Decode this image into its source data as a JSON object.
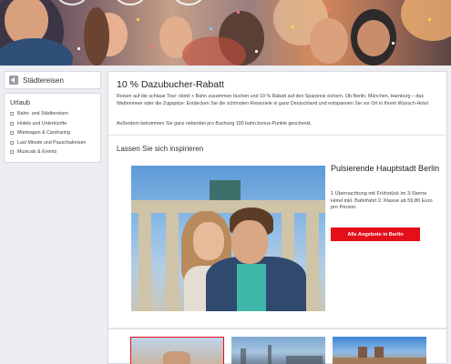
{
  "sidebar": {
    "back_label": "Städtereisen",
    "nav_title": "Urlaub",
    "items": [
      {
        "label": "Bahn- und Städtereisen"
      },
      {
        "label": "Hotels und Unterkünfte"
      },
      {
        "label": "Mietwagen & Carsharing"
      },
      {
        "label": "Last Minute und Pauschalreisen"
      },
      {
        "label": "Musicals & Events"
      }
    ]
  },
  "main": {
    "title": "10 % Dazubucher-Rabatt",
    "intro": "Reisen auf die schlaue Tour: Hotel + Bahn zusammen buchen und 10 % Rabatt auf den Sparpreis sichern. Ob Berlin, München, Hamburg – das Wattenmeer oder die Zugspitze: Entdecken Sie die schönsten Reiseziele in ganz Deutschland und entspannen Sie vor Ort in Ihrem Wunsch-Hotel.",
    "intro2": "Außerdem bekommen Sie ganz nebenbei pro Buchung 100 bahn.bonus-Punkte geschenkt.",
    "inspire_heading": "Lassen Sie sich inspirieren",
    "offer": {
      "city_title": "Pulsierende Hauptstadt Berlin",
      "description": "1 Übernachtung mit Frühstück im 3-Sterne Hotel inkl. Bahnfahrt 2. Klasse ab 59,80 Euro pro Person.",
      "button_label": "Alle Angebote in Berlin"
    }
  },
  "colors": {
    "accent_red": "#e3101a",
    "page_bg": "#eceef1"
  }
}
